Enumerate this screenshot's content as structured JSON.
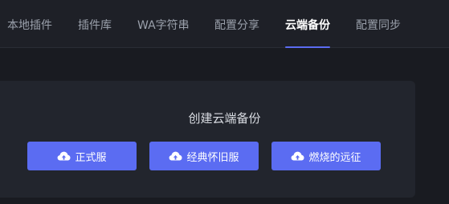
{
  "nav": {
    "tabs": [
      {
        "label": "本地插件"
      },
      {
        "label": "插件库"
      },
      {
        "label": "WA字符串"
      },
      {
        "label": "配置分享"
      },
      {
        "label": "云端备份"
      },
      {
        "label": "配置同步"
      }
    ],
    "active_tab": "云端备份"
  },
  "backup": {
    "title": "创建云端备份",
    "buttons": [
      {
        "label": "正式服",
        "icon": "cloud-upload-icon"
      },
      {
        "label": "经典怀旧服",
        "icon": "cloud-upload-icon"
      },
      {
        "label": "燃烧的远征",
        "icon": "cloud-upload-icon"
      }
    ]
  },
  "colors": {
    "accent": "#5b6cf2",
    "background": "#191b21",
    "card": "#22252d",
    "tab_inactive": "#9aa0ab",
    "tab_active": "#ffffff"
  }
}
